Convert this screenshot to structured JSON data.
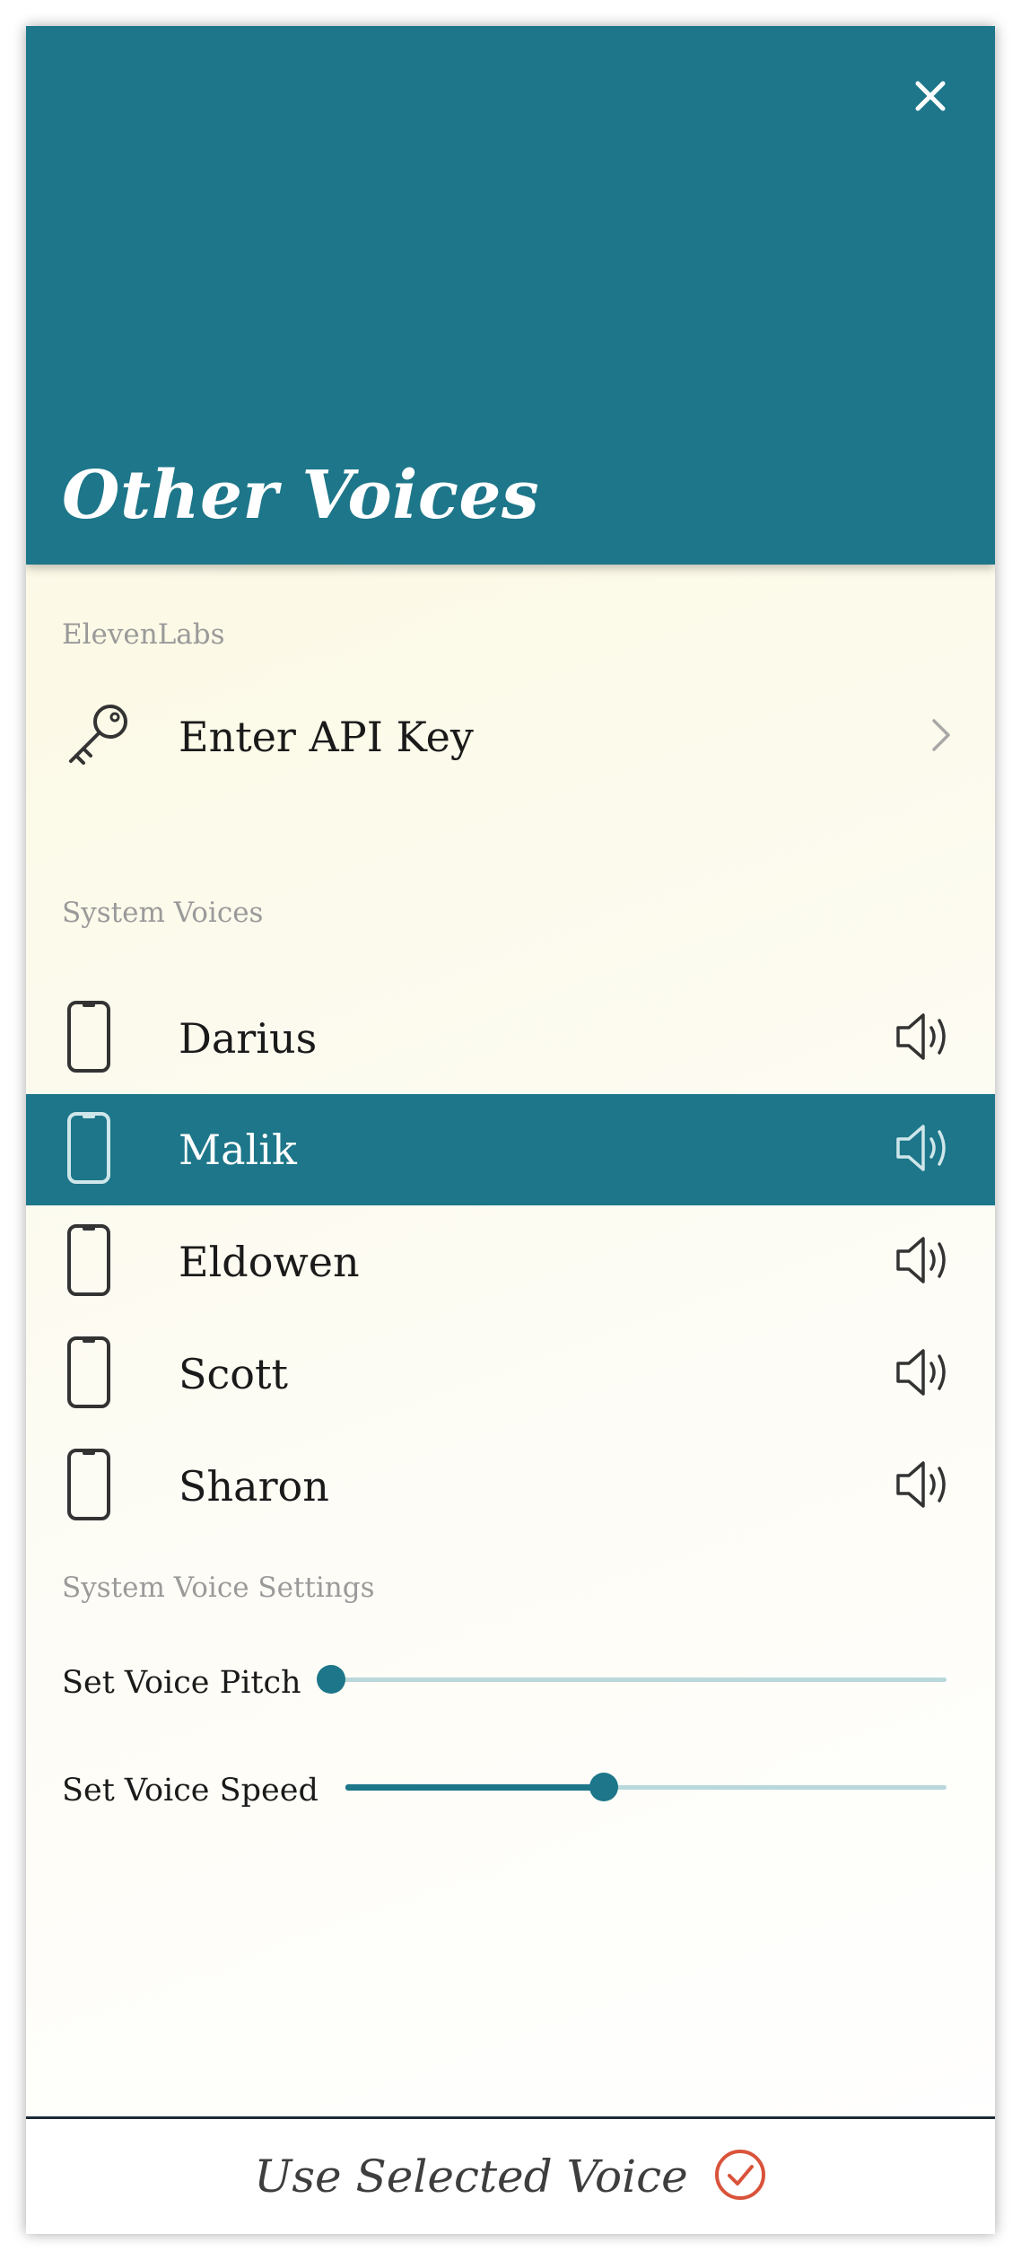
{
  "header": {
    "title": "Other Voices",
    "close_icon": "close-icon"
  },
  "elevenlabs": {
    "section_label": "ElevenLabs",
    "api_key_row": {
      "label": "Enter API Key",
      "icon": "key-icon",
      "trailing_icon": "chevron-right-icon"
    }
  },
  "system_voices": {
    "section_label": "System Voices",
    "items": [
      {
        "label": "Darius",
        "icon": "phone-icon",
        "trailing_icon": "speaker-icon",
        "selected": false
      },
      {
        "label": "Malik",
        "icon": "phone-icon",
        "trailing_icon": "speaker-icon",
        "selected": true
      },
      {
        "label": "Eldowen",
        "icon": "phone-icon",
        "trailing_icon": "speaker-icon",
        "selected": false
      },
      {
        "label": "Scott",
        "icon": "phone-icon",
        "trailing_icon": "speaker-icon",
        "selected": false
      },
      {
        "label": "Sharon",
        "icon": "phone-icon",
        "trailing_icon": "speaker-icon",
        "selected": false
      }
    ]
  },
  "settings": {
    "section_label": "System Voice Settings",
    "pitch": {
      "label": "Set Voice Pitch",
      "value_fraction": 0.0
    },
    "speed": {
      "label": "Set Voice Speed",
      "value_fraction": 0.43
    }
  },
  "footer": {
    "label": "Use Selected Voice",
    "icon": "check-circle-icon"
  },
  "colors": {
    "accent": "#1d7689",
    "check_icon": "#d9533a",
    "slider_track": "#b9d8db"
  }
}
